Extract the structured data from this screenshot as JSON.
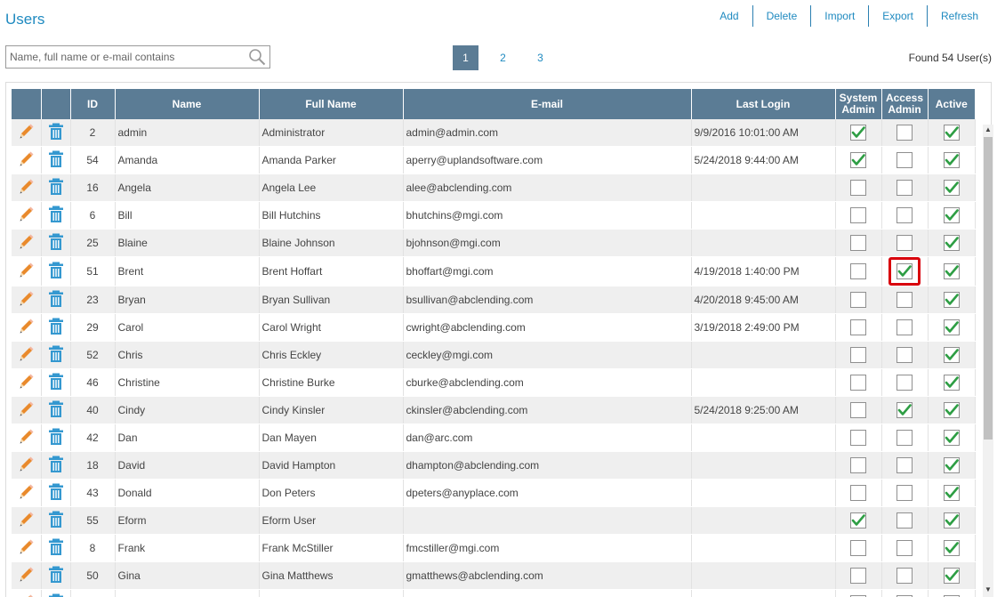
{
  "page": {
    "title": "Users"
  },
  "toolbar": {
    "add": "Add",
    "delete": "Delete",
    "import": "Import",
    "export": "Export",
    "refresh": "Refresh"
  },
  "search": {
    "placeholder": "Name, full name or e-mail contains",
    "value": "",
    "icon": "search-icon"
  },
  "pager": {
    "pages": [
      "1",
      "2",
      "3"
    ],
    "current": "1"
  },
  "found_text": "Found 54 User(s)",
  "colors": {
    "accent": "#1f8ac0",
    "header_bg": "#5b7c95",
    "check": "#2e9e44",
    "pencil": "#e98a2c",
    "trash": "#3498d0",
    "highlight": "#d8000c"
  },
  "table": {
    "columns": {
      "id": "ID",
      "name": "Name",
      "full_name": "Full Name",
      "email": "E-mail",
      "last_login": "Last Login",
      "system_admin_1": "System",
      "system_admin_2": "Admin",
      "access_admin_1": "Access",
      "access_admin_2": "Admin",
      "active": "Active"
    },
    "rows": [
      {
        "id": "2",
        "name": "admin",
        "full_name": "Administrator",
        "email": "admin@admin.com",
        "last_login": "9/9/2016 10:01:00 AM",
        "system_admin": true,
        "access_admin": false,
        "active": true
      },
      {
        "id": "54",
        "name": "Amanda",
        "full_name": "Amanda Parker",
        "email": "aperry@uplandsoftware.com",
        "last_login": "5/24/2018 9:44:00 AM",
        "system_admin": true,
        "access_admin": false,
        "active": true
      },
      {
        "id": "16",
        "name": "Angela",
        "full_name": "Angela Lee",
        "email": "alee@abclending.com",
        "last_login": "",
        "system_admin": false,
        "access_admin": false,
        "active": true
      },
      {
        "id": "6",
        "name": "Bill",
        "full_name": "Bill Hutchins",
        "email": "bhutchins@mgi.com",
        "last_login": "",
        "system_admin": false,
        "access_admin": false,
        "active": true
      },
      {
        "id": "25",
        "name": "Blaine",
        "full_name": "Blaine Johnson",
        "email": "bjohnson@mgi.com",
        "last_login": "",
        "system_admin": false,
        "access_admin": false,
        "active": true
      },
      {
        "id": "51",
        "name": "Brent",
        "full_name": "Brent Hoffart",
        "email": "bhoffart@mgi.com",
        "last_login": "4/19/2018 1:40:00 PM",
        "system_admin": false,
        "access_admin": true,
        "active": true,
        "highlight_access": true
      },
      {
        "id": "23",
        "name": "Bryan",
        "full_name": "Bryan Sullivan",
        "email": "bsullivan@abclending.com",
        "last_login": "4/20/2018 9:45:00 AM",
        "system_admin": false,
        "access_admin": false,
        "active": true
      },
      {
        "id": "29",
        "name": "Carol",
        "full_name": "Carol Wright",
        "email": "cwright@abclending.com",
        "last_login": "3/19/2018 2:49:00 PM",
        "system_admin": false,
        "access_admin": false,
        "active": true
      },
      {
        "id": "52",
        "name": "Chris",
        "full_name": "Chris Eckley",
        "email": "ceckley@mgi.com",
        "last_login": "",
        "system_admin": false,
        "access_admin": false,
        "active": true
      },
      {
        "id": "46",
        "name": "Christine",
        "full_name": "Christine Burke",
        "email": "cburke@abclending.com",
        "last_login": "",
        "system_admin": false,
        "access_admin": false,
        "active": true
      },
      {
        "id": "40",
        "name": "Cindy",
        "full_name": "Cindy Kinsler",
        "email": "ckinsler@abclending.com",
        "last_login": "5/24/2018 9:25:00 AM",
        "system_admin": false,
        "access_admin": true,
        "active": true
      },
      {
        "id": "42",
        "name": "Dan",
        "full_name": "Dan Mayen",
        "email": "dan@arc.com",
        "last_login": "",
        "system_admin": false,
        "access_admin": false,
        "active": true
      },
      {
        "id": "18",
        "name": "David",
        "full_name": "David Hampton",
        "email": "dhampton@abclending.com",
        "last_login": "",
        "system_admin": false,
        "access_admin": false,
        "active": true
      },
      {
        "id": "43",
        "name": "Donald",
        "full_name": "Don Peters",
        "email": "dpeters@anyplace.com",
        "last_login": "",
        "system_admin": false,
        "access_admin": false,
        "active": true
      },
      {
        "id": "55",
        "name": "Eform",
        "full_name": "Eform User",
        "email": "",
        "last_login": "",
        "system_admin": true,
        "access_admin": false,
        "active": true
      },
      {
        "id": "8",
        "name": "Frank",
        "full_name": "Frank McStiller",
        "email": "fmcstiller@mgi.com",
        "last_login": "",
        "system_admin": false,
        "access_admin": false,
        "active": true
      },
      {
        "id": "50",
        "name": "Gina",
        "full_name": "Gina Matthews",
        "email": "gmatthews@abclending.com",
        "last_login": "",
        "system_admin": false,
        "access_admin": false,
        "active": true
      },
      {
        "id": "",
        "name": "",
        "full_name": "",
        "email": "",
        "last_login": "",
        "system_admin": false,
        "access_admin": false,
        "active": true
      }
    ]
  }
}
